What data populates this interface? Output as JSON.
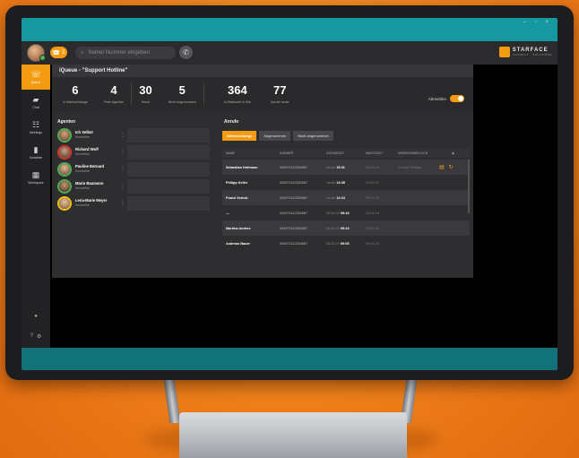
{
  "app": {
    "call_badge_count": "1",
    "search_placeholder": "Name/ Nummer eingeben",
    "brand_name": "STARFACE",
    "brand_sub": "CONNECT · SOLUTIONS",
    "window_controls": "– ▫ ×",
    "accent_color": "#f39c12",
    "status_color": "#49b84a"
  },
  "sidebar": {
    "items": [
      {
        "label": "Queue",
        "icon": "phone-icon",
        "glyph": "☏",
        "active": true
      },
      {
        "label": "Chat",
        "icon": "chat-icon",
        "glyph": "▰",
        "active": false
      },
      {
        "label": "Meetings",
        "icon": "meetings-icon",
        "glyph": "☷",
        "active": false
      },
      {
        "label": "Kontakte",
        "icon": "contacts-icon",
        "glyph": "▮",
        "active": false
      },
      {
        "label": "Workspace",
        "icon": "grid-icon",
        "glyph": "▦",
        "active": false
      }
    ],
    "bottom_icon": "●",
    "bottom_icons": [
      "?",
      "⚙"
    ]
  },
  "queue": {
    "title": "iQueue - \"Support Hotline\"",
    "stats": [
      {
        "value": "6",
        "label": "In Warteschlange"
      },
      {
        "value": "4",
        "label": "Freie Agenten"
      },
      {
        "value": "30",
        "label": "Heute"
      },
      {
        "value": "5",
        "label": "Nicht angenommen"
      },
      {
        "value": "364",
        "label": "In Wartezeit in Sek"
      },
      {
        "value": "77",
        "label": "Anrufe heute"
      }
    ],
    "toggle_label": "Abmelden"
  },
  "agents": {
    "title": "Agenten",
    "list": [
      {
        "name": "Ich Selbst",
        "sub": "Homeoffice",
        "status": "online"
      },
      {
        "name": "Richard Wolf",
        "sub": "Homeoffice",
        "status": "busy"
      },
      {
        "name": "Pauline Bernard",
        "sub": "Homeoffice",
        "status": "online"
      },
      {
        "name": "Mario Baumann",
        "sub": "Homeoffice",
        "status": "online"
      },
      {
        "name": "Lena-Marie Meyer",
        "sub": "Homeoffice",
        "status": "away"
      }
    ]
  },
  "calls": {
    "title": "Anrufe",
    "tabs": [
      "Warteschlange",
      "Angenommen",
      "Nicht angenommen"
    ],
    "columns": [
      "NAME",
      "NUMMER",
      "DATUM/ZEIT",
      "WARTEZEIT",
      "ÜBERNOMMEN VON"
    ],
    "rows": [
      {
        "name": "Sebastian Hofmann",
        "number": "004971112334567",
        "day": "Heute",
        "time": "15:31",
        "wait": "00:04:19",
        "taken": "Konrad Rüdiger"
      },
      {
        "name": "Philipp Keller",
        "number": "004971112334567",
        "day": "Heute",
        "time": "13:35",
        "wait": "00:08:31",
        "taken": ""
      },
      {
        "name": "Franzi Schulz",
        "number": "004971112334567",
        "day": "Heute",
        "time": "12:24",
        "wait": "00:07:24",
        "taken": ""
      },
      {
        "name": "—",
        "number": "004971112334567",
        "day": "03.05.20",
        "time": "09:44",
        "wait": "00:04:18",
        "taken": ""
      },
      {
        "name": "Martina Andres",
        "number": "004971112334567",
        "day": "03.05.20",
        "time": "09:24",
        "wait": "00:02:43",
        "taken": ""
      },
      {
        "name": "Andreas Bauer",
        "number": "004971112334567",
        "day": "03.05.20",
        "time": "09:05",
        "wait": "00:04:23",
        "taken": ""
      }
    ]
  }
}
